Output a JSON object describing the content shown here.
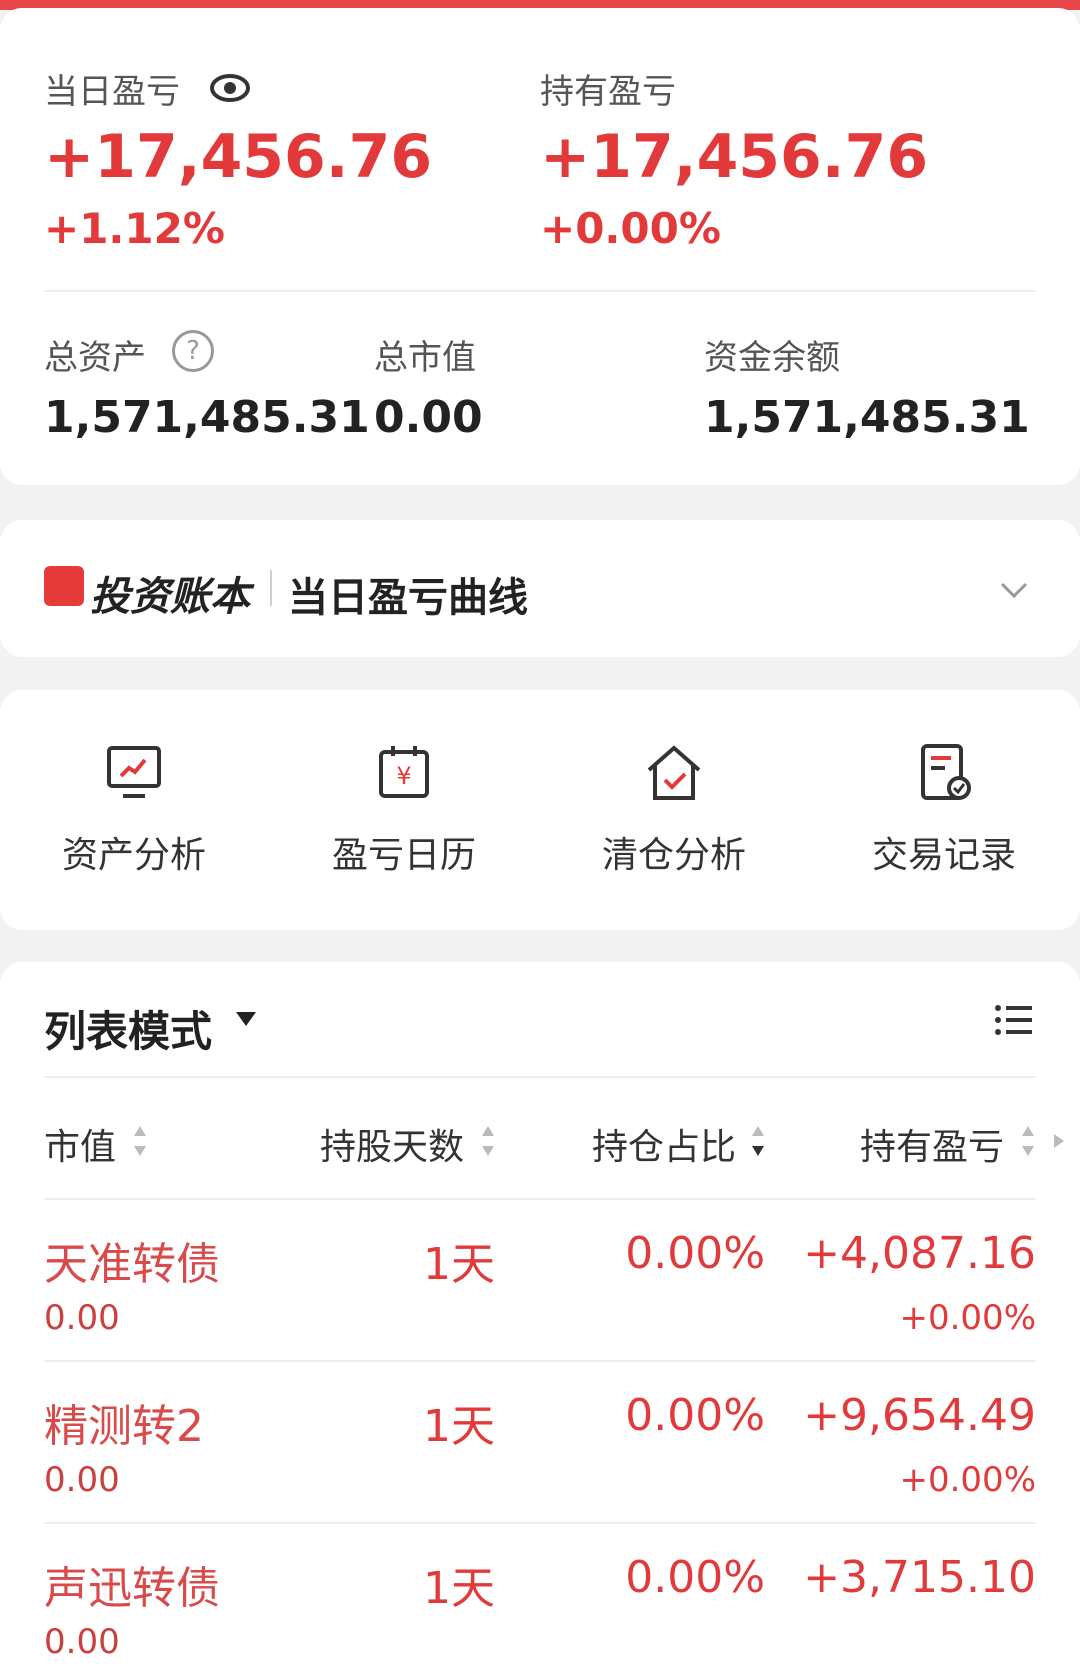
{
  "summary": {
    "daily_pnl_label": "当日盈亏",
    "daily_pnl_value": "+17,456.76",
    "daily_pnl_pct": "+1.12%",
    "holding_pnl_label": "持有盈亏",
    "holding_pnl_value": "+17,456.76",
    "holding_pnl_pct": "+0.00%",
    "total_assets_label": "总资产",
    "total_assets_value": "1,571,485.31",
    "market_value_label": "总市值",
    "market_value_value": "0.00",
    "cash_balance_label": "资金余额",
    "cash_balance_value": "1,571,485.31"
  },
  "curve": {
    "brand": "投资账本",
    "title": "当日盈亏曲线"
  },
  "tools": [
    {
      "label": "资产分析",
      "icon": "asset-analysis-icon"
    },
    {
      "label": "盈亏日历",
      "icon": "pnl-calendar-icon"
    },
    {
      "label": "清仓分析",
      "icon": "liquidation-analysis-icon"
    },
    {
      "label": "交易记录",
      "icon": "trade-record-icon"
    }
  ],
  "list": {
    "mode_label": "列表模式",
    "columns": [
      "市值",
      "持股天数",
      "持仓占比",
      "持有盈亏"
    ],
    "rows": [
      {
        "name": "天准转债",
        "market_value": "0.00",
        "days": "1天",
        "ratio": "0.00%",
        "pnl": "+4,087.16",
        "pnl_pct": "+0.00%"
      },
      {
        "name": "精测转2",
        "market_value": "0.00",
        "days": "1天",
        "ratio": "0.00%",
        "pnl": "+9,654.49",
        "pnl_pct": "+0.00%"
      },
      {
        "name": "声迅转债",
        "market_value": "0.00",
        "days": "1天",
        "ratio": "0.00%",
        "pnl": "+3,715.10",
        "pnl_pct": ""
      }
    ]
  },
  "colors": {
    "accent_red": "#e23a3a",
    "background": "#f2f2f2"
  }
}
